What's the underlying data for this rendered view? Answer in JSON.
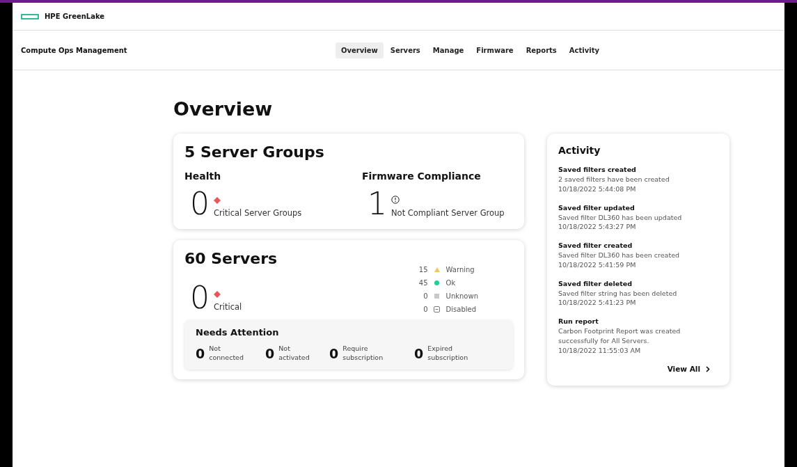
{
  "brand": {
    "name": "HPE GreenLake"
  },
  "app": {
    "title": "Compute Ops Management"
  },
  "tabs": [
    {
      "label": "Overview",
      "selected": true
    },
    {
      "label": "Servers",
      "selected": false
    },
    {
      "label": "Manage",
      "selected": false
    },
    {
      "label": "Firmware",
      "selected": false
    },
    {
      "label": "Reports",
      "selected": false
    },
    {
      "label": "Activity",
      "selected": false
    }
  ],
  "page_title": "Overview",
  "groups_card": {
    "title": "5 Server Groups",
    "sections": [
      {
        "heading": "Health",
        "count": "0",
        "kind": "critical",
        "label": "Critical Server Groups"
      },
      {
        "heading": "Firmware Compliance",
        "count": "1",
        "kind": "alert",
        "label": "Not Compliant Server Group"
      }
    ]
  },
  "servers_card": {
    "title": "60 Servers",
    "critical": {
      "count": "0",
      "label": "Critical"
    },
    "statuses": [
      {
        "count": "15",
        "kind": "warning",
        "label": "Warning"
      },
      {
        "count": "45",
        "kind": "ok",
        "label": "Ok"
      },
      {
        "count": "0",
        "kind": "unknown",
        "label": "Unknown"
      },
      {
        "count": "0",
        "kind": "disabled",
        "label": "Disabled"
      }
    ],
    "needs_attention": {
      "title": "Needs Attention",
      "items": [
        {
          "count": "0",
          "line1": "Not",
          "line2": "connected"
        },
        {
          "count": "0",
          "line1": "Not",
          "line2": "activated"
        },
        {
          "count": "0",
          "line1": "Require",
          "line2": "subscription"
        },
        {
          "count": "0",
          "line1": "Expired",
          "line2": "subscription"
        }
      ]
    }
  },
  "activity": {
    "title": "Activity",
    "items": [
      {
        "title": "Saved filters created",
        "text": "2 saved filters have been created",
        "time": "10/18/2022 5:44:08 PM"
      },
      {
        "title": "Saved filter updated",
        "text": "Saved filter DL360 has been updated",
        "time": "10/18/2022 5:43:27 PM"
      },
      {
        "title": "Saved filter created",
        "text": "Saved filter DL360 has been created",
        "time": "10/18/2022 5:41:59 PM"
      },
      {
        "title": "Saved filter deleted",
        "text": "Saved filter string has been deleted",
        "time": "10/18/2022 5:41:23 PM"
      },
      {
        "title": "Run report",
        "text": "Carbon Footprint Report was created successfully for All Servers.",
        "time": "10/18/2022 11:55:03 AM"
      }
    ],
    "view_all": "View All"
  }
}
